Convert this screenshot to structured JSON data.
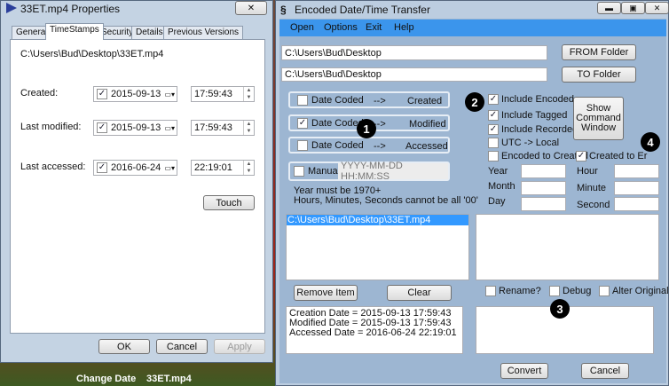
{
  "desktop": {
    "icons": [
      "Change Date",
      "33ET.mp4"
    ]
  },
  "props": {
    "title": "33ET.mp4 Properties",
    "close": "✕",
    "tabs": [
      "General",
      "TimeStamps",
      "Security",
      "Details",
      "Previous Versions"
    ],
    "active_tab": "TimeStamps",
    "path": "C:\\Users\\Bud\\Desktop\\33ET.mp4",
    "rows": [
      {
        "label": "Created:",
        "date": "2015-09-13",
        "time": "17:59:43",
        "checked": true
      },
      {
        "label": "Last modified:",
        "date": "2015-09-13",
        "time": "17:59:43",
        "checked": true
      },
      {
        "label": "Last accessed:",
        "date": "2016-06-24",
        "time": "22:19:01",
        "checked": true
      }
    ],
    "touch": "Touch",
    "ok": "OK",
    "cancel": "Cancel",
    "apply": "Apply"
  },
  "app": {
    "title": "Encoded Date/Time Transfer",
    "menu": [
      "Open",
      "Options",
      "Exit",
      "Help"
    ],
    "from_path": "C:\\Users\\Bud\\Desktop",
    "to_path": "C:\\Users\\Bud\\Desktop",
    "from_btn": "FROM Folder",
    "to_btn": "TO Folder",
    "maps": [
      {
        "src": "Date Coded",
        "arrow": "-->",
        "dst": "Created",
        "checked": false
      },
      {
        "src": "Date Coded",
        "arrow": "-->",
        "dst": "Modified",
        "checked": true
      },
      {
        "src": "Date Coded",
        "arrow": "-->",
        "dst": "Accessed",
        "checked": false
      }
    ],
    "manual": {
      "label": "Manual",
      "placeholder": "YYYY-MM-DD HH:MM:SS",
      "checked": false
    },
    "note1": "Year must be 1970+",
    "note2": "Hours, Minutes, Seconds cannot be all '00'",
    "options": [
      {
        "label": "Include Encoded",
        "checked": true
      },
      {
        "label": "Include Tagged",
        "checked": true
      },
      {
        "label": "Include Recorded",
        "checked": true
      },
      {
        "label": "UTC -> Local",
        "checked": false
      },
      {
        "label": "Encoded to Created",
        "checked": false
      }
    ],
    "created_to_er": {
      "label": "Created to Er",
      "checked": true
    },
    "show_cmd": "Show Command Window",
    "date_labels": [
      "Year",
      "Month",
      "Day"
    ],
    "time_labels": [
      "Hour",
      "Minute",
      "Second"
    ],
    "files": [
      "C:\\Users\\Bud\\Desktop\\33ET.mp4"
    ],
    "remove": "Remove Item",
    "clear": "Clear",
    "flags": [
      {
        "label": "Rename?",
        "checked": false
      },
      {
        "label": "Debug",
        "checked": false
      },
      {
        "label": "Alter Originals",
        "checked": false
      }
    ],
    "info": [
      "Creation Date = 2015-09-13 17:59:43",
      "Modified Date = 2015-09-13 17:59:43",
      "Accessed Date = 2016-06-24 22:19:01"
    ],
    "convert": "Convert",
    "cancel": "Cancel",
    "badges": [
      "1",
      "2",
      "3",
      "4"
    ],
    "colors": {
      "menu": "#3b95ec",
      "body": "#9db6d2"
    }
  }
}
